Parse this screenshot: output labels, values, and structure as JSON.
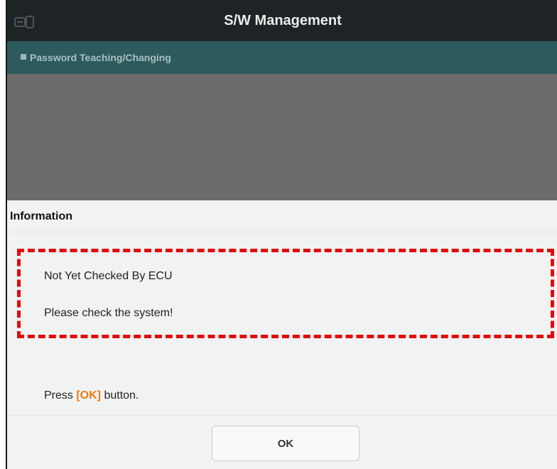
{
  "titlebar": {
    "title": "S/W Management",
    "icon": "vehicle-scan-icon"
  },
  "subbar": {
    "label": "Password Teaching/Changing"
  },
  "dialog": {
    "title": "Information",
    "message_line1": "Not Yet Checked By ECU",
    "message_line2": "Please check the system!",
    "instruction_prefix": "Press ",
    "instruction_highlight": "[OK]",
    "instruction_suffix": " button.",
    "ok_label": "OK"
  },
  "colors": {
    "titlebar_bg": "#1e2426",
    "subbar_bg": "#2c5a5d",
    "overlay_bg": "#6b6b6b",
    "dialog_bg": "#f1f3f3",
    "highlight_border": "#e10a0a",
    "ok_accent": "#f07a16"
  }
}
